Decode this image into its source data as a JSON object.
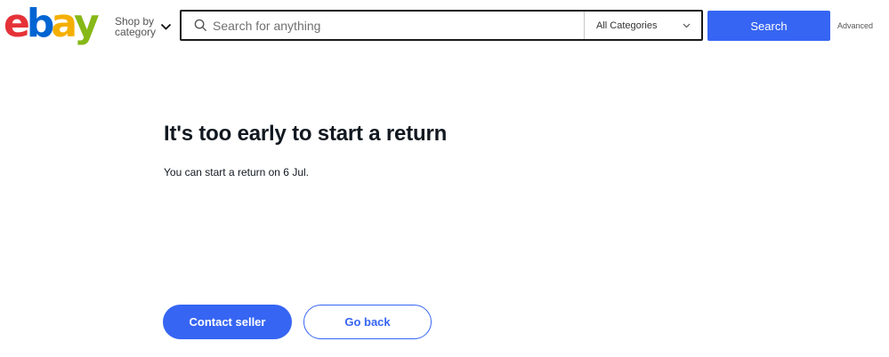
{
  "header": {
    "logo": {
      "letters": [
        "e",
        "b",
        "a",
        "y"
      ],
      "colors": [
        "#e53238",
        "#0064d2",
        "#f5af02",
        "#86b817"
      ]
    },
    "shop_by_category": "Shop by category",
    "search": {
      "placeholder": "Search for anything",
      "category": "All Categories",
      "button_label": "Search"
    },
    "advanced_label": "Advanced"
  },
  "main": {
    "title": "It's too early to start a return",
    "message": "You can start a return on 6 Jul.",
    "primary_button": "Contact seller",
    "secondary_button": "Go back"
  },
  "theme": {
    "accent": "#3665f3",
    "text": "#111820"
  }
}
